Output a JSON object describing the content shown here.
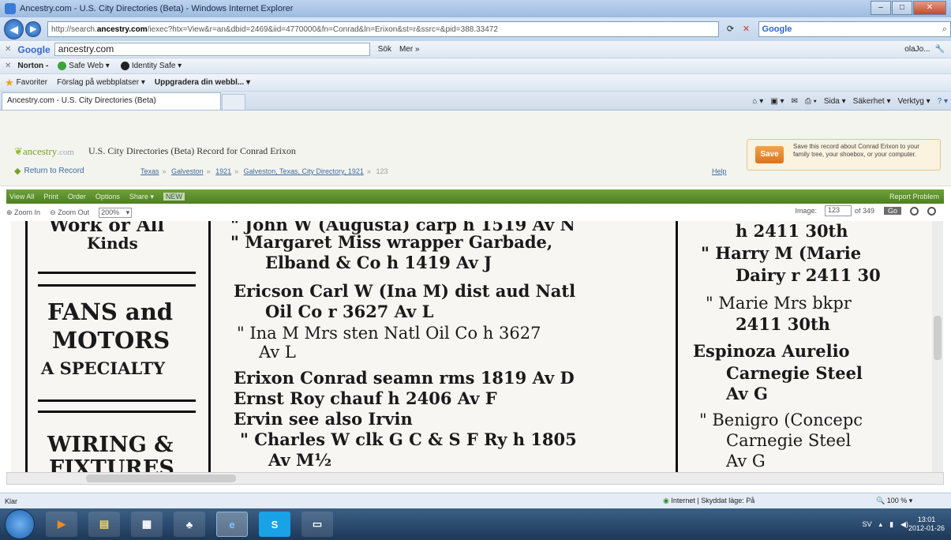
{
  "window": {
    "title": "Ancestry.com - U.S. City Directories (Beta) - Windows Internet Explorer"
  },
  "address": {
    "url_prefix": "http://search.",
    "url_host": "ancestry.com",
    "url_rest": "/iexec?htx=View&r=an&dbid=2469&iid=4770000&fn=Conrad&ln=Erixon&st=r&ssrc=&pid=388.33472",
    "search_engine": "Google",
    "search_placeholder": "Google"
  },
  "google_bar": {
    "logo": "Google",
    "query": "ancestry.com",
    "search_label": "Sök",
    "more_label": "Mer »",
    "user_label": "olaJo..."
  },
  "norton_bar": {
    "logo": "Norton -",
    "safe_web": "Safe Web ▾",
    "identity_safe": "Identity Safe ▾"
  },
  "favorites_bar": {
    "favorites": "Favoriter",
    "suggested": "Förslag på webbplatser ▾",
    "upgrade": "Uppgradera din webbl... ▾"
  },
  "tab": {
    "label": "Ancestry.com - U.S. City Directories (Beta)"
  },
  "command_bar": {
    "page": "Sida ▾",
    "security": "Säkerhet ▾",
    "tools": "Verktyg ▾"
  },
  "ancestry": {
    "logo": "ancestry",
    "logo_suffix": ".com",
    "record_title": "U.S. City Directories (Beta) Record for Conrad Erixon",
    "return_link": "Return to Record",
    "breadcrumb": [
      "Texas",
      "Galveston",
      "1921",
      "Galveston, Texas, City Directory, 1921",
      "123"
    ],
    "help": "Help",
    "save_button": "Save",
    "save_text": "Save this record about Conrad Erixon to your family tree, your shoebox, or your computer."
  },
  "viewer": {
    "view_all": "View All",
    "print": "Print",
    "order": "Order",
    "options": "Options",
    "share": "Share ▾",
    "new_badge": "NEW",
    "report": "Report Problem",
    "zoom_in": "Zoom In",
    "zoom_out": "Zoom Out",
    "zoom_level": "200%",
    "image_label": "Image:",
    "image_number": "123",
    "image_total": "of 349",
    "go": "Go"
  },
  "scan": {
    "ad_lines": [
      "Work or All",
      "Kinds",
      "FANS and",
      "MOTORS",
      "A SPECIALTY",
      "WIRING &",
      "FIXTURES"
    ],
    "col2": [
      "\" John W (Augusta) carp h 1519 Av N",
      "\" Margaret  Miss  wrapper  Garbade,",
      "Elband & Co h 1419 Av J",
      "Ericson Carl W (Ina M) dist aud Natl",
      "Oil Co r 3627 Av L",
      "\" Ina M Mrs sten Natl Oil Co h 3627",
      "Av L",
      "Erixon Conrad seamn rms 1819 Av D",
      "Ernst Roy chauf h 2406 Av F",
      "Ervin see also Irvin",
      "\" Charles W clk G C & S F Ry h 1805",
      "Av M½"
    ],
    "col3": [
      "h 2411 30th",
      "\" Harry  M  (Marie",
      "Dairy  r  2411  30",
      "\" Marie  Mrs  bkpr",
      "2411 30th",
      "Espinoza  Aurelio",
      "Carnegie  Steel",
      "Av G",
      "\" Benigro  (Concepc",
      "Carnegie  Steel",
      "Av G"
    ]
  },
  "status": {
    "left": "Klar",
    "zone": "Internet | Skyddat läge: På",
    "zoom": "100 %"
  },
  "taskbar": {
    "lang": "SV",
    "time": "13:01",
    "date": "2012-01-26"
  }
}
